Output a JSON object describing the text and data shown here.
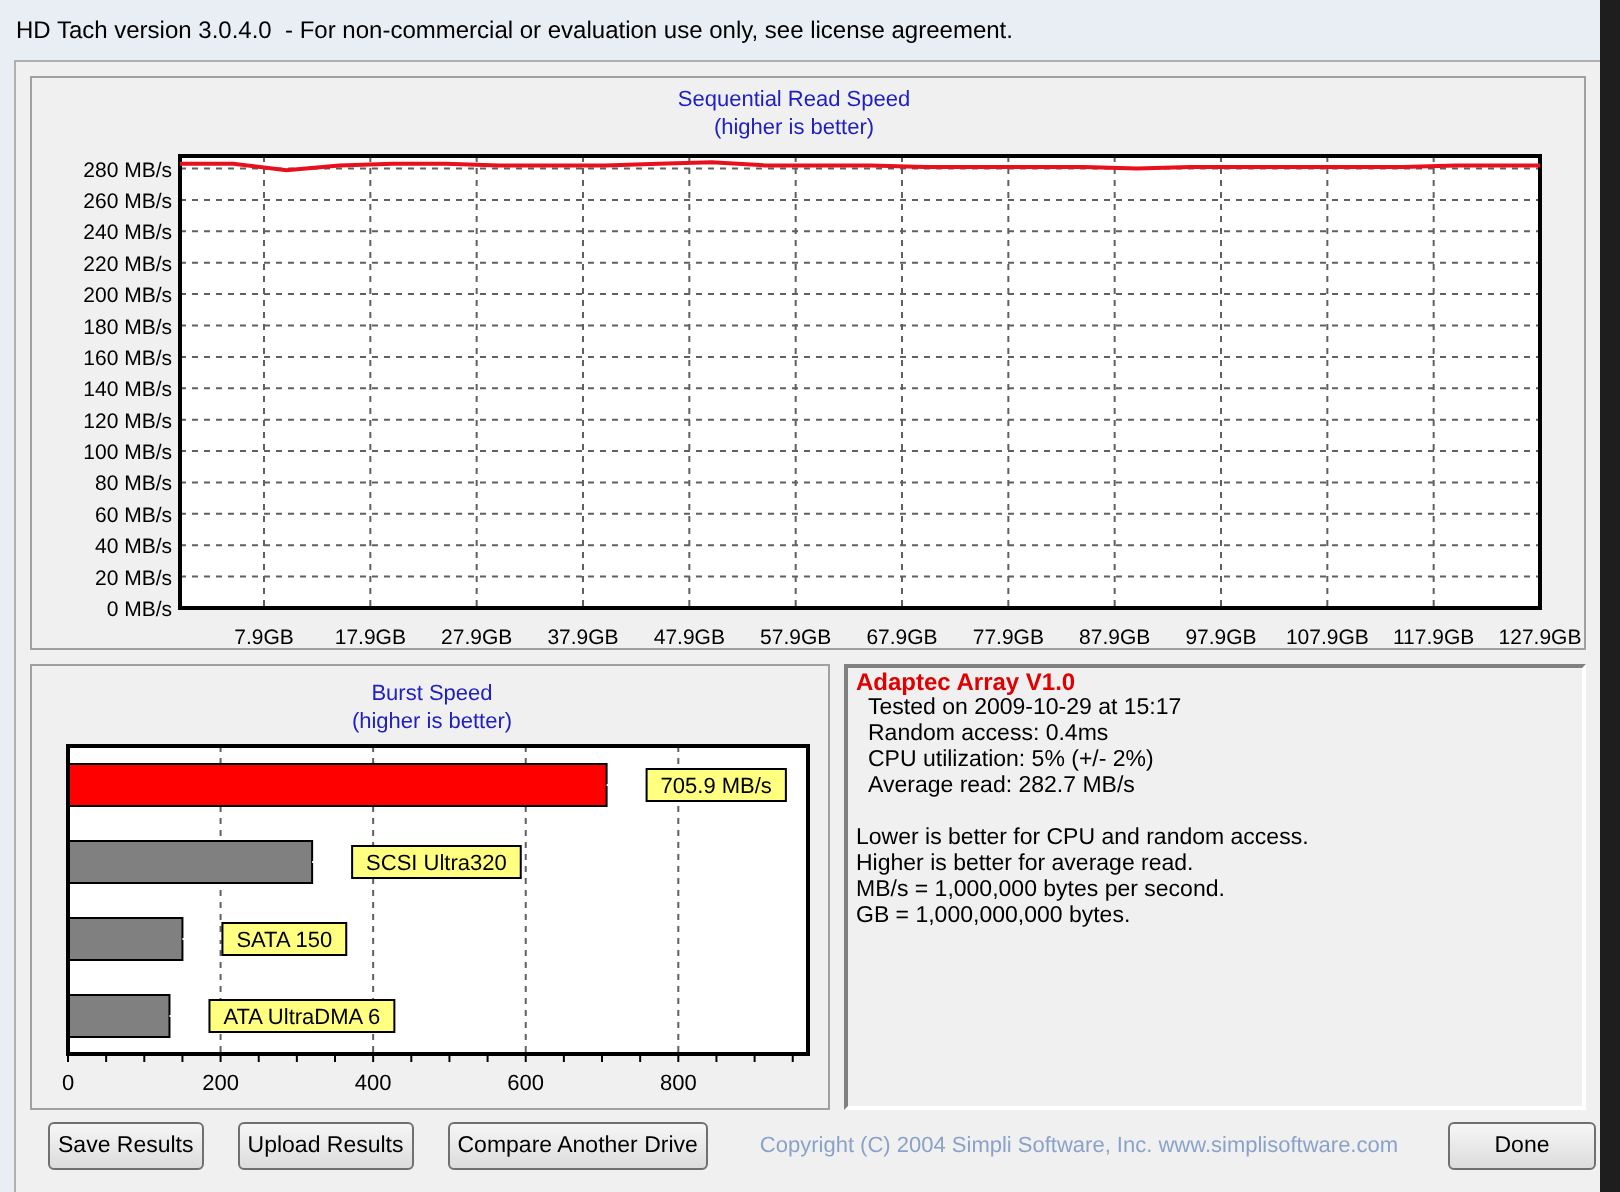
{
  "window": {
    "title": "HD Tach version 3.0.4.0  - For non-commercial or evaluation use only, see license agreement."
  },
  "read_chart": {
    "subtitle": "(higher is better)",
    "chart_data": {
      "type": "line",
      "title": "Sequential Read Speed",
      "xlim": [
        0,
        127.9
      ],
      "ylim": [
        0,
        288
      ],
      "x": [
        0,
        5,
        10,
        15,
        20,
        25,
        30,
        35,
        40,
        45,
        50,
        55,
        60,
        65,
        70,
        75,
        80,
        85,
        90,
        95,
        100,
        105,
        110,
        115,
        120,
        125,
        127.9
      ],
      "grid": true,
      "series": [
        {
          "color": "#e8101c",
          "values": [
            283,
            283,
            279,
            282,
            283,
            283,
            282,
            282,
            282,
            283,
            284,
            282,
            282,
            282,
            281,
            281,
            281,
            281,
            280,
            281,
            281,
            281,
            281,
            281,
            282,
            282,
            282
          ]
        }
      ],
      "yticks": [
        {
          "value": 0,
          "label": "0 MB/s"
        },
        {
          "value": 20,
          "label": "20 MB/s"
        },
        {
          "value": 40,
          "label": "40 MB/s"
        },
        {
          "value": 60,
          "label": "60 MB/s"
        },
        {
          "value": 80,
          "label": "80 MB/s"
        },
        {
          "value": 100,
          "label": "100 MB/s"
        },
        {
          "value": 120,
          "label": "120 MB/s"
        },
        {
          "value": 140,
          "label": "140 MB/s"
        },
        {
          "value": 160,
          "label": "160 MB/s"
        },
        {
          "value": 180,
          "label": "180 MB/s"
        },
        {
          "value": 200,
          "label": "200 MB/s"
        },
        {
          "value": 220,
          "label": "220 MB/s"
        },
        {
          "value": 240,
          "label": "240 MB/s"
        },
        {
          "value": 260,
          "label": "260 MB/s"
        },
        {
          "value": 280,
          "label": "280 MB/s"
        }
      ],
      "xticks": [
        {
          "value": 7.9,
          "label": "7.9GB"
        },
        {
          "value": 17.9,
          "label": "17.9GB"
        },
        {
          "value": 27.9,
          "label": "27.9GB"
        },
        {
          "value": 37.9,
          "label": "37.9GB"
        },
        {
          "value": 47.9,
          "label": "47.9GB"
        },
        {
          "value": 57.9,
          "label": "57.9GB"
        },
        {
          "value": 67.9,
          "label": "67.9GB"
        },
        {
          "value": 77.9,
          "label": "77.9GB"
        },
        {
          "value": 87.9,
          "label": "87.9GB"
        },
        {
          "value": 97.9,
          "label": "97.9GB"
        },
        {
          "value": 107.9,
          "label": "107.9GB"
        },
        {
          "value": 117.9,
          "label": "117.9GB"
        },
        {
          "value": 127.9,
          "label": "127.9GB"
        }
      ]
    }
  },
  "burst_chart": {
    "subtitle": "(higher is better)",
    "chart_data": {
      "type": "bar",
      "orientation": "horizontal",
      "title": "Burst Speed",
      "xlim": [
        0,
        970
      ],
      "categories": [
        "705.9 MB/s",
        "SCSI Ultra320",
        "SATA 150",
        "ATA UltraDMA 6"
      ],
      "grid": true,
      "series": [
        {
          "color": "#ff0000",
          "values": [
            706,
            null,
            null,
            null
          ]
        },
        {
          "color": "#808080",
          "values": [
            null,
            320,
            150,
            133
          ]
        }
      ],
      "xticks": [
        0,
        200,
        400,
        600,
        800
      ]
    }
  },
  "info": {
    "drive": "Adaptec Array V1.0",
    "details": [
      "Tested on 2009-10-29 at 15:17",
      "Random access: 0.4ms",
      "CPU utilization: 5% (+/- 2%)",
      "Average read: 282.7 MB/s"
    ],
    "notes": [
      "Lower is better for CPU and random access.",
      "Higher is better for average read.",
      "MB/s = 1,000,000 bytes per second.",
      "GB = 1,000,000,000 bytes."
    ]
  },
  "buttons": [
    "Save Results",
    "Upload Results",
    "Compare Another Drive"
  ],
  "copyright": "Copyright (C) 2004 Simpli Software, Inc. www.simplisoftware.com",
  "done_button": "Done"
}
